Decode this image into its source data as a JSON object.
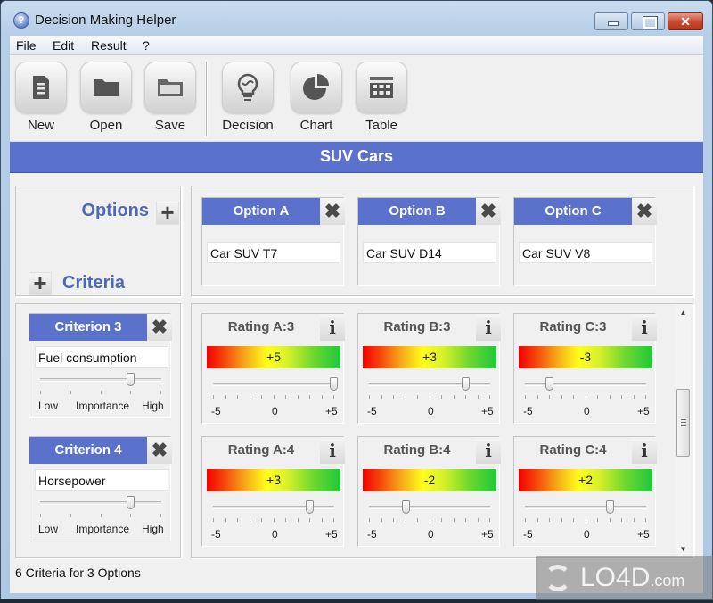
{
  "window": {
    "title": "Decision Making Helper",
    "controls": {
      "minimize": "minimize",
      "maximize": "maximize",
      "close": "✕"
    }
  },
  "menu": [
    "File",
    "Edit",
    "Result",
    "?"
  ],
  "toolbar": {
    "buttons": [
      {
        "label": "New",
        "icon": "document-icon"
      },
      {
        "label": "Open",
        "icon": "folder-icon"
      },
      {
        "label": "Save",
        "icon": "save-folder-icon"
      },
      {
        "label": "Decision",
        "icon": "lightbulb-icon"
      },
      {
        "label": "Chart",
        "icon": "pie-chart-icon"
      },
      {
        "label": "Table",
        "icon": "table-icon"
      }
    ]
  },
  "banner": {
    "title": "SUV Cars"
  },
  "header": {
    "options_label": "Options",
    "criteria_label": "Criteria",
    "add_symbol": "+",
    "remove_symbol": "✖"
  },
  "options": [
    {
      "label": "Option A",
      "value": "Car SUV T7"
    },
    {
      "label": "Option B",
      "value": "Car SUV D14"
    },
    {
      "label": "Option C",
      "value": "Car SUV V8"
    }
  ],
  "importance_scale": {
    "low": "Low",
    "mid": "Importance",
    "high": "High"
  },
  "criteria": [
    {
      "label": "Criterion 3",
      "value": "Fuel consumption",
      "importance": 0.75,
      "ratings": [
        {
          "label": "Rating A:3",
          "value": 5,
          "display": "+5"
        },
        {
          "label": "Rating B:3",
          "value": 3,
          "display": "+3"
        },
        {
          "label": "Rating C:3",
          "value": -3,
          "display": "-3"
        }
      ]
    },
    {
      "label": "Criterion 4",
      "value": "Horsepower",
      "importance": 0.75,
      "ratings": [
        {
          "label": "Rating A:4",
          "value": 3,
          "display": "+3"
        },
        {
          "label": "Rating B:4",
          "value": -2,
          "display": "-2"
        },
        {
          "label": "Rating C:4",
          "value": 2,
          "display": "+2"
        }
      ]
    }
  ],
  "rating_scale": {
    "min": -5,
    "max": 5,
    "min_label": "-5",
    "mid_label": "0",
    "max_label": "+5"
  },
  "info_symbol": "i",
  "scrollbar": {
    "up": "▲",
    "down": "▼",
    "position": 0.45
  },
  "status": {
    "text": "6 Criteria for 3 Options"
  },
  "watermark": {
    "text": "LO4D",
    "suffix": ".com"
  }
}
